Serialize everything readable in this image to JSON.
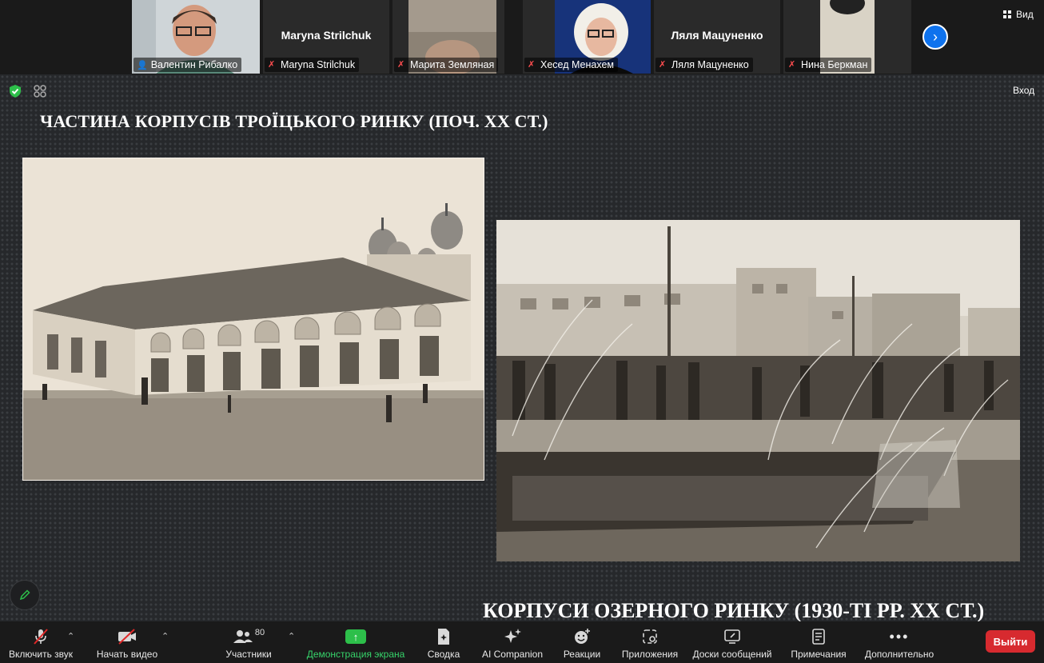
{
  "view_label": "Вид",
  "participants": [
    {
      "name": "Валентин Рибалко",
      "video": true,
      "muted": false
    },
    {
      "name": "Maryna Strilchuk",
      "center_name": "Maryna Strilchuk",
      "video": false,
      "muted": true
    },
    {
      "name": "Марита Земляная",
      "video": true,
      "muted": true
    },
    {
      "name": "Хесед Менахем",
      "video": true,
      "muted": true
    },
    {
      "name": "Ляля Мацуненко",
      "center_name": "Ляля Мацуненко",
      "video": false,
      "muted": true
    },
    {
      "name": "Нина Беркман",
      "video": true,
      "muted": true
    }
  ],
  "stage": {
    "enter_label": "Вход",
    "title_top": "ЧАСТИНА КОРПУСІВ ТРОЇЦЬКОГО РИНКУ (ПОЧ. ХХ СТ.)",
    "title_bottom": "КОРПУСИ ОЗЕРНОГО РИНКУ (1930-ТІ РР. ХХ СТ.)"
  },
  "toolbar": {
    "unmute": "Включить звук",
    "start_video": "Начать видео",
    "participants": "Участники",
    "participants_count": "80",
    "share": "Демонстрация экрана",
    "summary": "Сводка",
    "ai": "AI Companion",
    "reactions": "Реакции",
    "apps": "Приложения",
    "whiteboards": "Доски сообщений",
    "notes": "Примечания",
    "more": "Дополнительно",
    "leave": "Выйти"
  },
  "colors": {
    "accent_green": "#2dbf4a",
    "leave_red": "#d72a2f",
    "blue": "#0e72ed"
  }
}
